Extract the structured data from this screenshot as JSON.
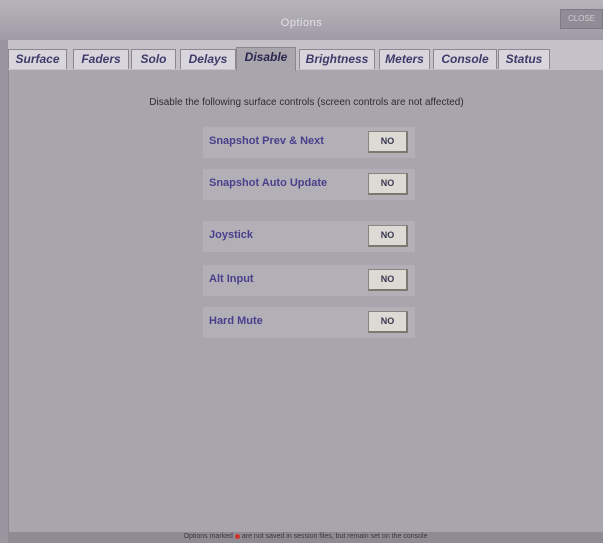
{
  "window": {
    "title": "Options",
    "close_label": "CLOSE"
  },
  "tabs": [
    {
      "label": "Surface"
    },
    {
      "label": "Faders"
    },
    {
      "label": "Solo"
    },
    {
      "label": "Delays"
    },
    {
      "label": "Disable"
    },
    {
      "label": "Brightness"
    },
    {
      "label": "Meters"
    },
    {
      "label": "Console"
    },
    {
      "label": "Status"
    }
  ],
  "active_tab": "Disable",
  "panel": {
    "instruction": "Disable the following surface controls (screen controls are not affected)",
    "options": [
      {
        "label": "Snapshot Prev & Next",
        "value": "NO"
      },
      {
        "label": "Snapshot Auto Update",
        "value": "NO"
      },
      {
        "label": "Joystick",
        "value": "NO"
      },
      {
        "label": "Alt Input",
        "value": "NO"
      },
      {
        "label": "Hard Mute",
        "value": "NO"
      }
    ]
  },
  "footer": {
    "note_before": "Options marked",
    "note_after": "are not saved in session files, but remain set on the console",
    "marker_color": "#d0342c"
  }
}
